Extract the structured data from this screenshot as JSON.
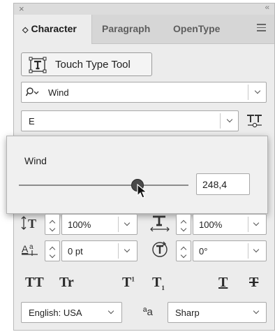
{
  "panel": {
    "close_glyph": "×",
    "collapse_glyph": "‹‹",
    "tabs": [
      {
        "label": "Character",
        "active": true,
        "glyph": "◇"
      },
      {
        "label": "Paragraph",
        "active": false
      },
      {
        "label": "OpenType",
        "active": false
      }
    ]
  },
  "touch_type": {
    "label": "Touch Type Tool"
  },
  "font_family": {
    "value": "Wind"
  },
  "font_style": {
    "value": "E"
  },
  "popup": {
    "label": "Wind",
    "slider_value": 248.4,
    "value_text": "248,4"
  },
  "leading": {
    "value": "100%"
  },
  "horizontal_scale": {
    "value": "100%"
  },
  "baseline_shift": {
    "value": "0 pt"
  },
  "rotation": {
    "value": "0°"
  },
  "style_buttons": {
    "all_caps": "TT",
    "small_caps": "Tr",
    "superscript": "T",
    "superscript_mark": "1",
    "subscript": "T",
    "subscript_mark": "1",
    "underline": "T",
    "strikethrough": "T"
  },
  "language": {
    "value": "English: USA"
  },
  "antialias": {
    "glyph": "ªa",
    "value": "Sharp"
  },
  "colors": {
    "panel_bg": "#ececec",
    "tab_bg": "#d6d6d6",
    "field_border": "#a8a8a8",
    "knob": "#4a4a4a"
  }
}
